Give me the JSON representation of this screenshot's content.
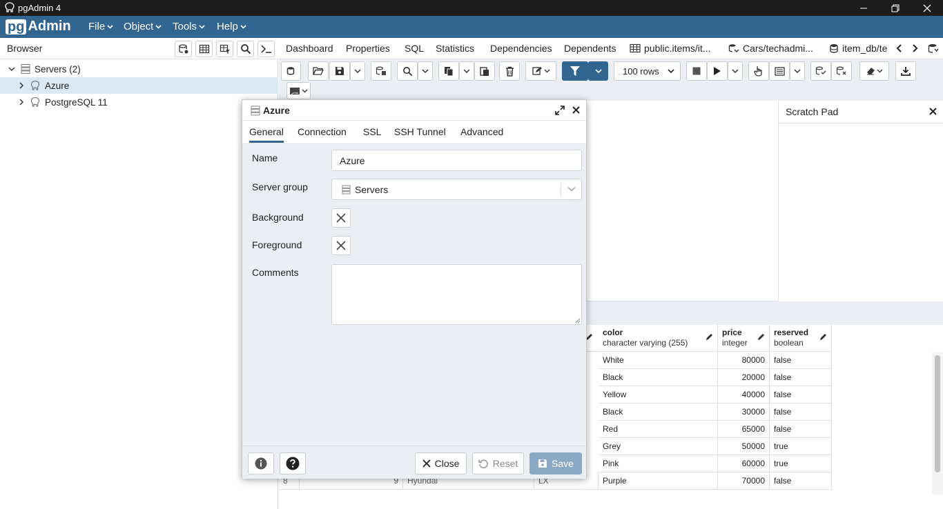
{
  "window": {
    "title": "pgAdmin 4"
  },
  "brand": {
    "pg": "pg",
    "admin": "Admin"
  },
  "menu": {
    "items": [
      "File",
      "Object",
      "Tools",
      "Help"
    ]
  },
  "browser": {
    "title": "Browser",
    "tree": {
      "servers_label": "Servers (2)",
      "nodes": [
        "Azure",
        "PostgreSQL 11"
      ]
    }
  },
  "tabs": {
    "items": [
      "Dashboard",
      "Properties",
      "SQL",
      "Statistics",
      "Dependencies",
      "Dependents",
      "public.items/it...",
      "Cars/techadmi...",
      "item_db/te"
    ]
  },
  "toolbar": {
    "rows_select": "100 rows"
  },
  "scratch_pad": {
    "title": "Scratch Pad"
  },
  "grid": {
    "columns": [
      {
        "name": "color",
        "type": "character varying (255)"
      },
      {
        "name": "price",
        "type": "integer"
      },
      {
        "name": "reserved",
        "type": "boolean"
      }
    ],
    "rows": [
      [
        "White",
        "80000",
        "false"
      ],
      [
        "Black",
        "20000",
        "false"
      ],
      [
        "Yellow",
        "40000",
        "false"
      ],
      [
        "Black",
        "30000",
        "false"
      ],
      [
        "Red",
        "65000",
        "false"
      ],
      [
        "Grey",
        "50000",
        "true"
      ],
      [
        "Pink",
        "60000",
        "true"
      ],
      [
        "Purple",
        "70000",
        "false"
      ]
    ],
    "partial_row": {
      "row_num": "8",
      "id": "9",
      "make": "Hyundai",
      "model": "LX"
    }
  },
  "dialog": {
    "title": "Azure",
    "tabs": [
      "General",
      "Connection",
      "SSL",
      "SSH Tunnel",
      "Advanced"
    ],
    "fields": {
      "name_label": "Name",
      "name_value": "Azure",
      "server_group_label": "Server group",
      "server_group_value": "Servers",
      "background_label": "Background",
      "foreground_label": "Foreground",
      "comments_label": "Comments",
      "comments_value": ""
    },
    "buttons": {
      "close": "Close",
      "reset": "Reset",
      "save": "Save"
    }
  },
  "colors": {
    "brand": "#326690",
    "save_disabled": "#8aa9c5"
  }
}
